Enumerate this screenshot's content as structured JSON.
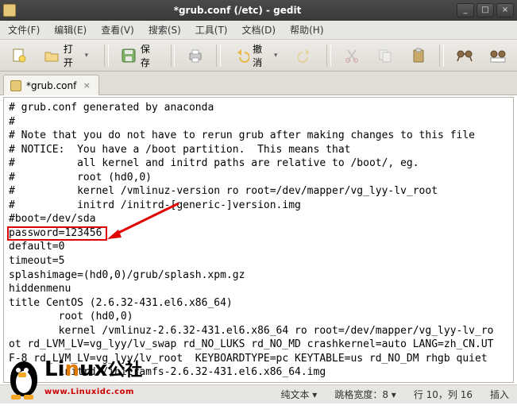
{
  "window": {
    "title": "*grub.conf (/etc) - gedit",
    "minimize": "_",
    "maximize": "□",
    "close": "×"
  },
  "menu": {
    "file": "文件(F)",
    "edit": "编辑(E)",
    "view": "查看(V)",
    "search": "搜索(S)",
    "tools": "工具(T)",
    "documents": "文档(D)",
    "help": "帮助(H)"
  },
  "toolbar": {
    "open": "打开",
    "save": "保存",
    "undo": "撤消"
  },
  "tab": {
    "label": "*grub.conf"
  },
  "editor": {
    "lines": [
      "# grub.conf generated by anaconda",
      "#",
      "# Note that you do not have to rerun grub after making changes to this file",
      "# NOTICE:  You have a /boot partition.  This means that",
      "#          all kernel and initrd paths are relative to /boot/, eg.",
      "#          root (hd0,0)",
      "#          kernel /vmlinuz-version ro root=/dev/mapper/vg_lyy-lv_root",
      "#          initrd /initrd-[generic-]version.img",
      "#boot=/dev/sda",
      "password=123456",
      "default=0",
      "timeout=5",
      "splashimage=(hd0,0)/grub/splash.xpm.gz",
      "hiddenmenu",
      "title CentOS (2.6.32-431.el6.x86_64)",
      "        root (hd0,0)",
      "        kernel /vmlinuz-2.6.32-431.el6.x86_64 ro root=/dev/mapper/vg_lyy-lv_root rd_LVM_LV=vg_lyy/lv_swap rd_NO_LUKS rd_NO_MD crashkernel=auto LANG=zh_CN.UTF-8 rd_LVM_LV=vg_lyy/lv_root  KEYBOARDTYPE=pc KEYTABLE=us rd_NO_DM rhgb quiet",
      "        initrd /initramfs-2.6.32-431.el6.x86_64.img"
    ]
  },
  "status": {
    "mode": "纯文本 ▾",
    "tabwidth": "跳格宽度：8 ▾",
    "position": "行 10，列 16",
    "insert": "插入"
  },
  "watermark": {
    "brand1": "Li",
    "brand2": "n",
    "brand3": "ux",
    "brand4": "公社",
    "url": "www.Linuxidc.com"
  }
}
